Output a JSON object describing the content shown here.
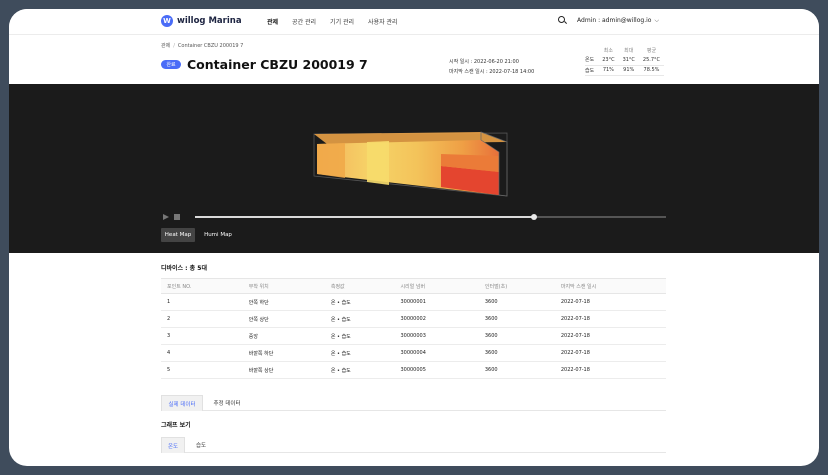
{
  "nav": {
    "brand": "willog Marina",
    "logo_letter": "W",
    "menu": [
      "관제",
      "공간 관리",
      "기기 관리",
      "사용자 관리"
    ],
    "user": "Admin : admin@willog.io"
  },
  "breadcrumb": {
    "root": "관제",
    "separator": "/",
    "current": "Container CBZU 200019 7"
  },
  "header": {
    "status": "완료",
    "title": "Container CBZU 200019 7",
    "start_label": "시작 일시 : 2022-06-20 21:00",
    "last_scan_label": "마지막 스캔 일시 : 2022-07-18 14:00"
  },
  "stats": {
    "columns": [
      "최소",
      "최대",
      "평균"
    ],
    "rows": [
      {
        "label": "온도",
        "values": [
          "23°C",
          "31°C",
          "25.7°C"
        ]
      },
      {
        "label": "습도",
        "values": [
          "71%",
          "91%",
          "78.5%"
        ]
      }
    ]
  },
  "player": {
    "progress": 0.72
  },
  "map_tabs": {
    "heat": "Heat Map",
    "humi": "Humi Map"
  },
  "heat_colors": [
    "#f3c35a",
    "#f6d468",
    "#f0a848",
    "#eb8a3c",
    "#e4452f"
  ],
  "devices": {
    "title": "디바이스 : 총 5대",
    "columns": [
      "포인트 NO.",
      "부착 위치",
      "측정값",
      "시리얼 넘버",
      "인터벌(초)",
      "마지막 스캔 일시"
    ],
    "rows": [
      [
        "1",
        "안쪽 하단",
        "온 • 습도",
        "30000001",
        "3600",
        "2022-07-18"
      ],
      [
        "2",
        "안쪽 상단",
        "온 • 습도",
        "30000002",
        "3600",
        "2022-07-18"
      ],
      [
        "3",
        "중앙",
        "온 • 습도",
        "30000003",
        "3600",
        "2022-07-18"
      ],
      [
        "4",
        "바깥쪽 하단",
        "온 • 습도",
        "30000004",
        "3600",
        "2022-07-18"
      ],
      [
        "5",
        "바깥쪽 상단",
        "온 • 습도",
        "30000005",
        "3600",
        "2022-07-18"
      ]
    ]
  },
  "data_tabs": {
    "actual": "실제 데이터",
    "estimated": "추정 데이터"
  },
  "graph": {
    "title": "그래프 보기",
    "tabs": [
      "온도",
      "습도"
    ]
  }
}
